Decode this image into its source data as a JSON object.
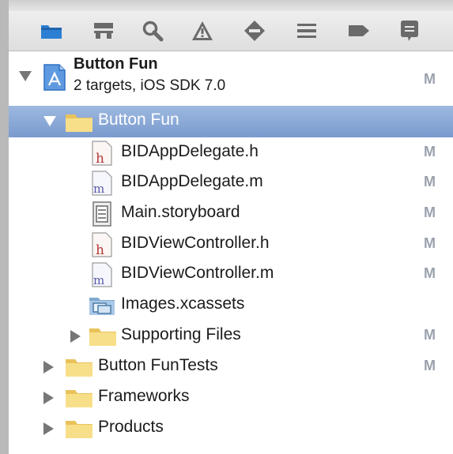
{
  "toolbar": {
    "items": [
      {
        "icon": "folder-icon",
        "label": "Project navigator"
      },
      {
        "icon": "hierarchy-icon",
        "label": "Symbol navigator"
      },
      {
        "icon": "search-icon",
        "label": "Find navigator"
      },
      {
        "icon": "warning-icon",
        "label": "Issue navigator"
      },
      {
        "icon": "test-diamond-icon",
        "label": "Test navigator"
      },
      {
        "icon": "debug-icon",
        "label": "Debug navigator"
      },
      {
        "icon": "breakpoint-icon",
        "label": "Breakpoint navigator"
      },
      {
        "icon": "log-icon",
        "label": "Log navigator"
      }
    ],
    "active_index": 0
  },
  "project": {
    "name": "Button Fun",
    "subtitle": "2 targets, iOS SDK 7.0",
    "status": "M"
  },
  "tree": [
    {
      "label": "Button Fun",
      "kind": "group",
      "status": "",
      "selected": true
    },
    {
      "label": "BIDAppDelegate.h",
      "kind": "h-file",
      "status": "M"
    },
    {
      "label": "BIDAppDelegate.m",
      "kind": "m-file",
      "status": "M"
    },
    {
      "label": "Main.storyboard",
      "kind": "storyboard",
      "status": "M"
    },
    {
      "label": "BIDViewController.h",
      "kind": "h-file",
      "status": "M"
    },
    {
      "label": "BIDViewController.m",
      "kind": "m-file",
      "status": "M"
    },
    {
      "label": "Images.xcassets",
      "kind": "asset-catalog",
      "status": ""
    },
    {
      "label": "Supporting Files",
      "kind": "group",
      "status": "M"
    },
    {
      "label": "Button FunTests",
      "kind": "group",
      "status": "M"
    },
    {
      "label": "Frameworks",
      "kind": "group",
      "status": ""
    },
    {
      "label": "Products",
      "kind": "group",
      "status": ""
    }
  ],
  "glyphs": {
    "h": "h",
    "m": "m"
  },
  "colors": {
    "selection": "#7f9fd2",
    "status_gray": "#9aa2ad",
    "folder": "#f4d77a",
    "active_tab": "#2d7fd3"
  }
}
